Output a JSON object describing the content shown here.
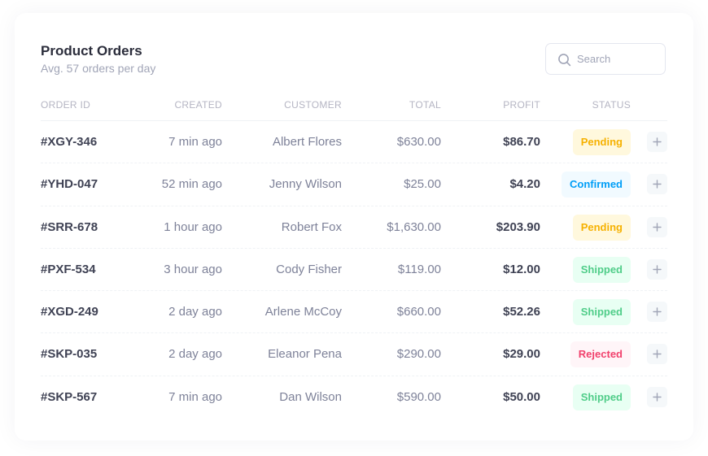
{
  "header": {
    "title": "Product Orders",
    "subtitle": "Avg. 57 orders per day"
  },
  "search": {
    "placeholder": "Search",
    "value": "",
    "icon": "search-icon"
  },
  "table": {
    "columns": {
      "order_id": "ORDER ID",
      "created": "CREATED",
      "customer": "CUSTOMER",
      "total": "TOTAL",
      "profit": "PROFIT",
      "status": "STATUS"
    },
    "rows": [
      {
        "order_id": "#XGY-346",
        "created": "7 min ago",
        "customer": "Albert Flores",
        "total": "$630.00",
        "profit": "$86.70",
        "status": "Pending",
        "status_type": "pending"
      },
      {
        "order_id": "#YHD-047",
        "created": "52 min ago",
        "customer": "Jenny Wilson",
        "total": "$25.00",
        "profit": "$4.20",
        "status": "Confirmed",
        "status_type": "confirmed"
      },
      {
        "order_id": "#SRR-678",
        "created": "1 hour ago",
        "customer": "Robert Fox",
        "total": "$1,630.00",
        "profit": "$203.90",
        "status": "Pending",
        "status_type": "pending"
      },
      {
        "order_id": "#PXF-534",
        "created": "3 hour ago",
        "customer": "Cody Fisher",
        "total": "$119.00",
        "profit": "$12.00",
        "status": "Shipped",
        "status_type": "shipped"
      },
      {
        "order_id": "#XGD-249",
        "created": "2 day ago",
        "customer": "Arlene McCoy",
        "total": "$660.00",
        "profit": "$52.26",
        "status": "Shipped",
        "status_type": "shipped"
      },
      {
        "order_id": "#SKP-035",
        "created": "2 day ago",
        "customer": "Eleanor Pena",
        "total": "$290.00",
        "profit": "$29.00",
        "status": "Rejected",
        "status_type": "rejected"
      },
      {
        "order_id": "#SKP-567",
        "created": "7 min ago",
        "customer": "Dan Wilson",
        "total": "$590.00",
        "profit": "$50.00",
        "status": "Shipped",
        "status_type": "shipped"
      }
    ],
    "row_action_icon": "plus-icon"
  },
  "colors": {
    "pending": "#f6b100",
    "confirmed": "#009ef7",
    "shipped": "#50cd89",
    "rejected": "#f1416c",
    "heading": "#2b2d3b",
    "muted": "#a1a5b7"
  }
}
